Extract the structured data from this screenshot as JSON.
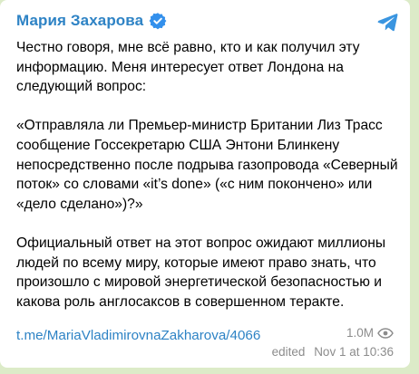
{
  "post": {
    "author": "Мария Захарова",
    "paragraphs": [
      "Честно говоря, мне всё равно, кто и как получил эту информацию. Меня интересует ответ Лондона на следующий вопрос:",
      "«Отправляла ли Премьер-министр Британии Лиз Трасс сообщение Госсекретарю США Энтони Блинкену непосредственно после подрыва газопровода «Северный поток» со словами «it’s done» («с ним покончено» или «дело сделано»)?»",
      "Официальный ответ на этот вопрос ожидают миллионы людей по всему миру, которые имеют право знать, что произошло с мировой энергетической безопасностью и какова роль англосаксов в совершенном теракте."
    ],
    "link": "t.me/MariaVladimirovnaZakharova/4066",
    "views": "1.0M",
    "edited_label": "edited",
    "timestamp": "Nov 1 at 10:36"
  },
  "icons": {
    "verified": "verified-badge-icon",
    "share": "telegram-share-icon",
    "views": "eye-icon"
  },
  "colors": {
    "accent": "#2e83c5",
    "meta": "#8c8c8c",
    "background": "#dcebc8",
    "card": "#ffffff"
  }
}
